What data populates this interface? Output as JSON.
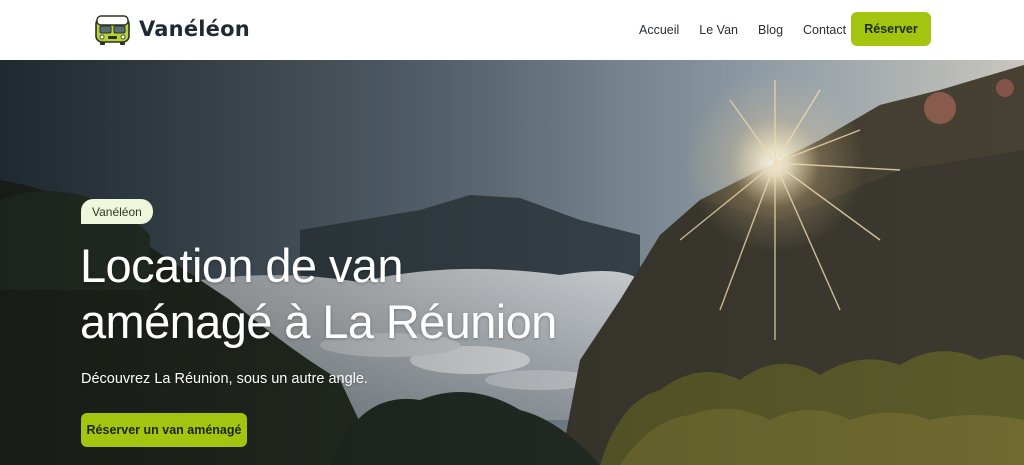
{
  "brand": {
    "name": "Vanéléon",
    "logo_icon": "van-icon"
  },
  "nav": {
    "items": [
      {
        "label": "Accueil"
      },
      {
        "label": "Le Van"
      },
      {
        "label": "Blog"
      },
      {
        "label": "Contact"
      }
    ],
    "cta_label": "Réserver"
  },
  "hero": {
    "badge": "Vanéléon",
    "title_line1": "Location de van",
    "title_line2": "aménagé à La Réunion",
    "subtitle": "Découvrez La Réunion, sous un autre angle.",
    "cta_label": "Réserver un van aménagé"
  },
  "colors": {
    "accent": "#a4c50f",
    "badge_bg": "#eef6dc",
    "text_dark": "#1f2a33"
  }
}
